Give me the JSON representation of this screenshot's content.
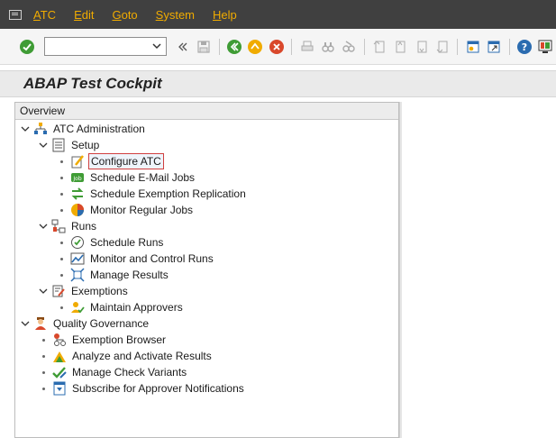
{
  "menu": {
    "items": [
      {
        "label": "ATC"
      },
      {
        "label": "Edit"
      },
      {
        "label": "Goto"
      },
      {
        "label": "System"
      },
      {
        "label": "Help"
      }
    ]
  },
  "toolbar": {
    "command_value": ""
  },
  "title": "ABAP Test Cockpit",
  "tree": {
    "header": "Overview",
    "nodes": [
      {
        "label": "ATC Administration"
      },
      {
        "label": "Setup"
      },
      {
        "label": "Configure ATC"
      },
      {
        "label": "Schedule E-Mail Jobs"
      },
      {
        "label": "Schedule Exemption Replication"
      },
      {
        "label": "Monitor Regular Jobs"
      },
      {
        "label": "Runs"
      },
      {
        "label": "Schedule Runs"
      },
      {
        "label": "Monitor and Control Runs"
      },
      {
        "label": "Manage Results"
      },
      {
        "label": "Exemptions"
      },
      {
        "label": "Maintain Approvers"
      },
      {
        "label": "Quality Governance"
      },
      {
        "label": "Exemption Browser"
      },
      {
        "label": "Analyze and Activate Results"
      },
      {
        "label": "Manage Check Variants"
      },
      {
        "label": "Subscribe for Approver Notifications"
      }
    ]
  },
  "colors": {
    "menu_bg": "#404040",
    "menu_text": "#f0ab00",
    "selected_border": "#d04040"
  }
}
